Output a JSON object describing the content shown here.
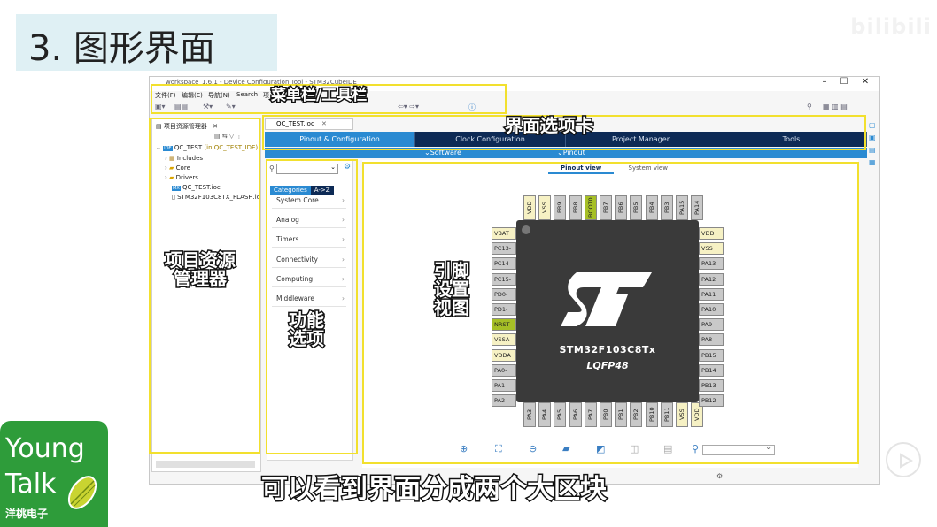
{
  "slide": {
    "title": "3. 图形界面",
    "watermark": "bilibili",
    "subtitle": "可以看到界面分成两个大区块"
  },
  "logo": {
    "line1": "Young",
    "line2": "Talk",
    "line3": "洋桃电子"
  },
  "ide": {
    "window_title": "workspace_1.6.1 - Device Configuration Tool - STM32CubeIDE",
    "menu": [
      "文件(F)",
      "编辑(E)",
      "导航(N)",
      "Search",
      "项"
    ],
    "explorer": {
      "title": "项目资源管理器",
      "project": "QC_TEST",
      "project_suffix": "(in QC_TEST_IDE)",
      "items": [
        "Includes",
        "Core",
        "Drivers",
        "QC_TEST.ioc",
        "STM32F103C8TX_FLASH.ld"
      ]
    },
    "editor_tab": "QC_TEST.ioc",
    "config_tabs": [
      "Pinout & Configuration",
      "Clock Configuration",
      "Project Manager",
      "Tools"
    ],
    "sub_menu": [
      "Software Packs",
      "Pinout"
    ],
    "category_tabs": [
      "Categories",
      "A->Z"
    ],
    "categories": [
      "System Core",
      "Analog",
      "Timers",
      "Connectivity",
      "Computing",
      "Middleware"
    ],
    "view_tabs": [
      "Pinout view",
      "System view"
    ],
    "chip": {
      "name": "STM32F103C8Tx",
      "package": "LQFP48"
    },
    "pins_top": [
      "VDD",
      "VSS",
      "PB9",
      "PB8",
      "BOOT0",
      "PB7",
      "PB6",
      "PB5",
      "PB4",
      "PB3",
      "PA15",
      "PA14"
    ],
    "pins_left": [
      "VBAT",
      "PC13-",
      "PC14-",
      "PC15-",
      "PD0-",
      "PD1-",
      "NRST",
      "VSSA",
      "VDDA",
      "PA0-",
      "PA1",
      "PA2"
    ],
    "pins_right": [
      "VDD",
      "VSS",
      "PA13",
      "PA12",
      "PA11",
      "PA10",
      "PA9",
      "PA8",
      "PB15",
      "PB14",
      "PB13",
      "PB12"
    ],
    "pins_bottom": [
      "PA3",
      "PA4",
      "PA5",
      "PA6",
      "PA7",
      "PB0",
      "PB1",
      "PB2",
      "PB10",
      "PB11",
      "VSS",
      "VDD"
    ]
  },
  "annotations": {
    "menu_toolbar": "菜单栏/工具栏",
    "tabs": "界面选项卡",
    "explorer": "项目资源\n管理器",
    "functions": "功能\n选项",
    "pin_view": "引脚\n设置\n视图"
  }
}
